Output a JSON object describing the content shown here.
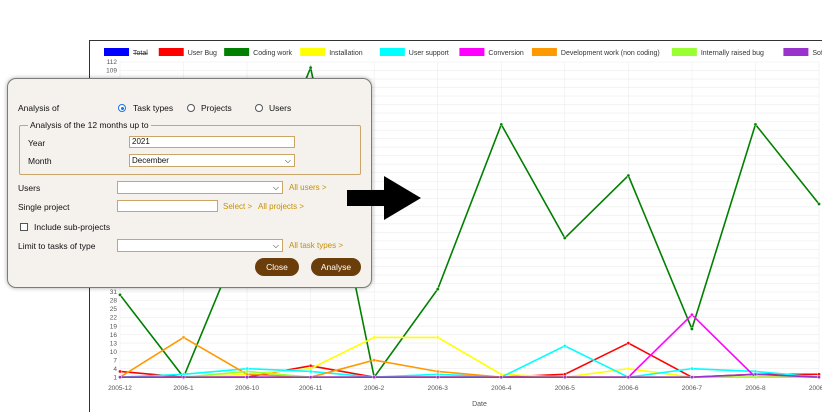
{
  "chart_data": {
    "type": "line",
    "x": [
      "2005-12",
      "2006-1",
      "2006-10",
      "2006-11",
      "2006-2",
      "2006-3",
      "2006-4",
      "2006-5",
      "2006-6",
      "2006-7",
      "2006-8",
      "2006-9"
    ],
    "xlabel": "Date",
    "ylabel": "",
    "ylim": [
      0,
      112
    ],
    "yticks_visible": [
      1,
      4,
      7,
      10,
      13,
      16,
      19,
      22,
      25,
      28,
      31,
      109,
      112
    ],
    "legend_position": "top",
    "series": [
      {
        "name": "Total",
        "color": "#0000ff",
        "strikethrough": true,
        "values": [
          null,
          null,
          null,
          null,
          null,
          null,
          null,
          null,
          null,
          null,
          null,
          null
        ]
      },
      {
        "name": "User Bug",
        "color": "#ff0000",
        "values": [
          3,
          1,
          1,
          5,
          1,
          1,
          1,
          2,
          13,
          1,
          2,
          2
        ]
      },
      {
        "name": "Coding work",
        "color": "#008000",
        "values": [
          30,
          1,
          55,
          110,
          1,
          32,
          90,
          50,
          72,
          18,
          90,
          62
        ]
      },
      {
        "name": "Installation",
        "color": "#ffff00",
        "values": [
          1,
          1,
          2,
          4,
          15,
          15,
          2,
          1,
          4,
          1,
          1,
          1
        ]
      },
      {
        "name": "User support",
        "color": "#00ffff",
        "values": [
          1,
          2,
          4,
          3,
          1,
          2,
          1,
          12,
          1,
          4,
          3,
          1
        ]
      },
      {
        "name": "Conversion",
        "color": "#ff00ff",
        "values": [
          1,
          1,
          1,
          1,
          1,
          1,
          1,
          1,
          1,
          23,
          1,
          1
        ]
      },
      {
        "name": "Development work (non coding)",
        "color": "#ff9900",
        "values": [
          1,
          15,
          2,
          1,
          7,
          3,
          1,
          1,
          1,
          1,
          1,
          1
        ]
      },
      {
        "name": "Internally raised bug",
        "color": "#99ff33",
        "values": [
          1,
          1,
          3,
          1,
          1,
          1,
          1,
          1,
          1,
          1,
          1,
          1
        ]
      },
      {
        "name": "Software update",
        "color": "#9933cc",
        "values": [
          1,
          1,
          1,
          1,
          1,
          1,
          1,
          1,
          1,
          1,
          2,
          1
        ]
      }
    ]
  },
  "dialog": {
    "analysis_of_label": "Analysis of",
    "radio_options": [
      {
        "label": "Task types",
        "checked": true
      },
      {
        "label": "Projects",
        "checked": false
      },
      {
        "label": "Users",
        "checked": false
      }
    ],
    "fieldset_legend": "Analysis of the 12 months up to",
    "year_label": "Year",
    "year_value": "2021",
    "month_label": "Month",
    "month_value": "December",
    "users_label": "Users",
    "users_value": "",
    "all_users_link": "All users >",
    "single_project_label": "Single project",
    "single_project_value": "",
    "select_link": "Select >",
    "all_projects_link": "All projects >",
    "include_subprojects_label": "Include sub-projects",
    "limit_label": "Limit to tasks of type",
    "limit_value": "",
    "all_task_types_link": "All task types >",
    "close_button": "Close",
    "analyse_button": "Analyse",
    "accent_color": "#6b3d0a",
    "border_color": "#c9a56a",
    "link_color": "#c79000"
  },
  "overlay": {
    "arrow_icon": "right-arrow-icon"
  }
}
